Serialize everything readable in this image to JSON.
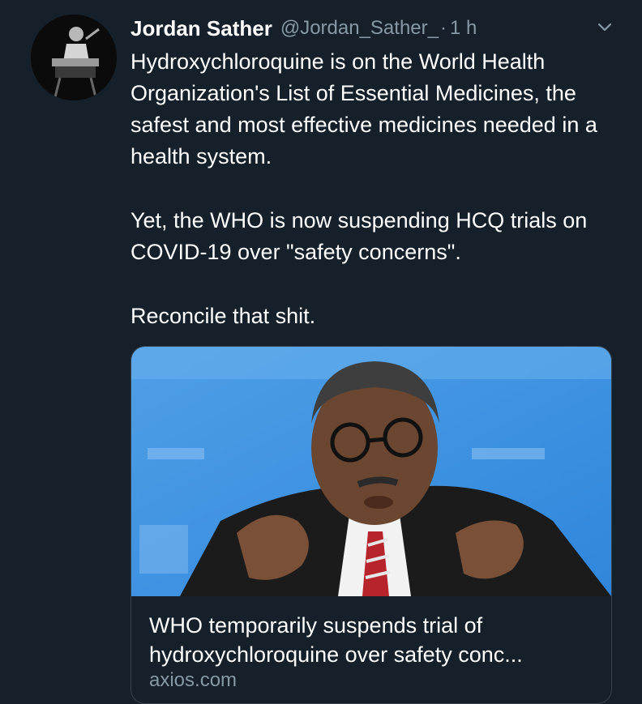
{
  "tweet": {
    "avatar_icon": "profile-photo",
    "display_name": "Jordan Sather",
    "handle": "@Jordan_Sather_",
    "separator": "·",
    "time": "1 h",
    "menu_icon": "chevron-down-icon",
    "paragraphs": [
      "Hydroxychloroquine is on the World Health Organization's List of Essential Medicines, the safest and most effective medicines needed in a health system.",
      "Yet, the WHO is now suspending HCQ trials on COVID-19 over \"safety concerns\".",
      "Reconcile that shit."
    ]
  },
  "card": {
    "image_icon": "article-photo",
    "title": "WHO temporarily suspends trial of hydroxychloroquine over safety conc...",
    "domain": "axios.com"
  },
  "colors": {
    "background": "#15202b",
    "text": "#ffffff",
    "muted": "#8899a6",
    "border": "#38444d"
  }
}
